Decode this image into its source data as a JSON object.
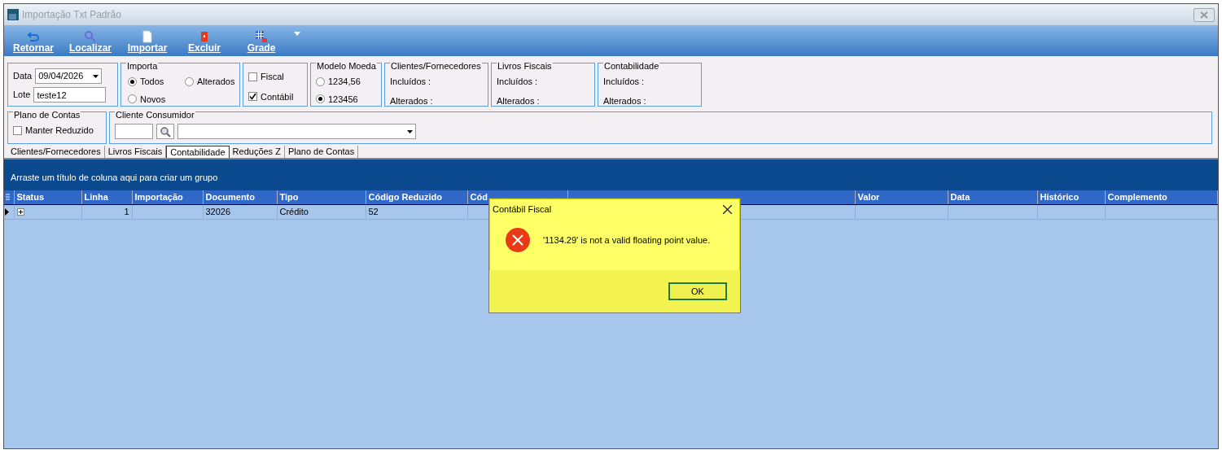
{
  "window": {
    "title": "Importação Txt Padrão"
  },
  "toolbar": [
    {
      "label": "Retornar"
    },
    {
      "label": "Localizar"
    },
    {
      "label": "Importar"
    },
    {
      "label": "Excluir"
    },
    {
      "label": "Grade"
    }
  ],
  "filters": {
    "data_label": "Data",
    "data_value": "09/04/2026",
    "lote_label": "Lote",
    "lote_value": "teste12",
    "importa": {
      "title": "Importa",
      "options": [
        {
          "label": "Todos",
          "selected": true
        },
        {
          "label": "Alterados",
          "selected": false
        },
        {
          "label": "Novos",
          "selected": false
        }
      ]
    },
    "checks": [
      {
        "label": "Fiscal",
        "checked": false
      },
      {
        "label": "Contábil",
        "checked": true
      }
    ],
    "modelo_moeda": {
      "title": "Modelo Moeda",
      "options": [
        {
          "label": "1234,56",
          "selected": false
        },
        {
          "label": "123456",
          "selected": true
        }
      ]
    },
    "summaries": [
      {
        "title": "Clientes/Fornecedores",
        "lines": [
          "Incluídos :",
          "Alterados :"
        ]
      },
      {
        "title": "Livros Fiscais",
        "lines": [
          "Incluídos :",
          "Alterados :"
        ]
      },
      {
        "title": "Contabilidade",
        "lines": [
          "Incluídos :",
          "Alterados :"
        ]
      }
    ]
  },
  "plano_de_contas": {
    "title": "Plano de Contas",
    "option": {
      "label": "Manter Reduzido",
      "checked": false
    }
  },
  "cliente_consumidor": {
    "title": "Cliente Consumidor"
  },
  "tabs": [
    {
      "label": "Clientes/Fornecedores",
      "selected": false
    },
    {
      "label": "Livros Fiscais",
      "selected": false
    },
    {
      "label": "Contabilidade",
      "selected": true
    },
    {
      "label": "Reduções Z",
      "selected": false
    },
    {
      "label": "Plano de Contas",
      "selected": false
    }
  ],
  "grid": {
    "group_hint": "Arraste um título de coluna aqui para criar um grupo",
    "columns": [
      "Status",
      "Linha",
      "Importação",
      "Documento",
      "Tipo",
      "Código Reduzido",
      "Cód",
      null,
      "Valor",
      "Data",
      "Histórico",
      "Complemento"
    ],
    "rows": [
      {
        "selected": true,
        "cells": [
          "",
          "1",
          "",
          "32026",
          "Crédito",
          "52",
          "",
          "",
          "",
          "",
          "",
          ""
        ]
      }
    ]
  },
  "dialog": {
    "title": "Contábil Fiscal",
    "message": "'1134.29' is not a valid floating point value.",
    "button": "OK"
  }
}
